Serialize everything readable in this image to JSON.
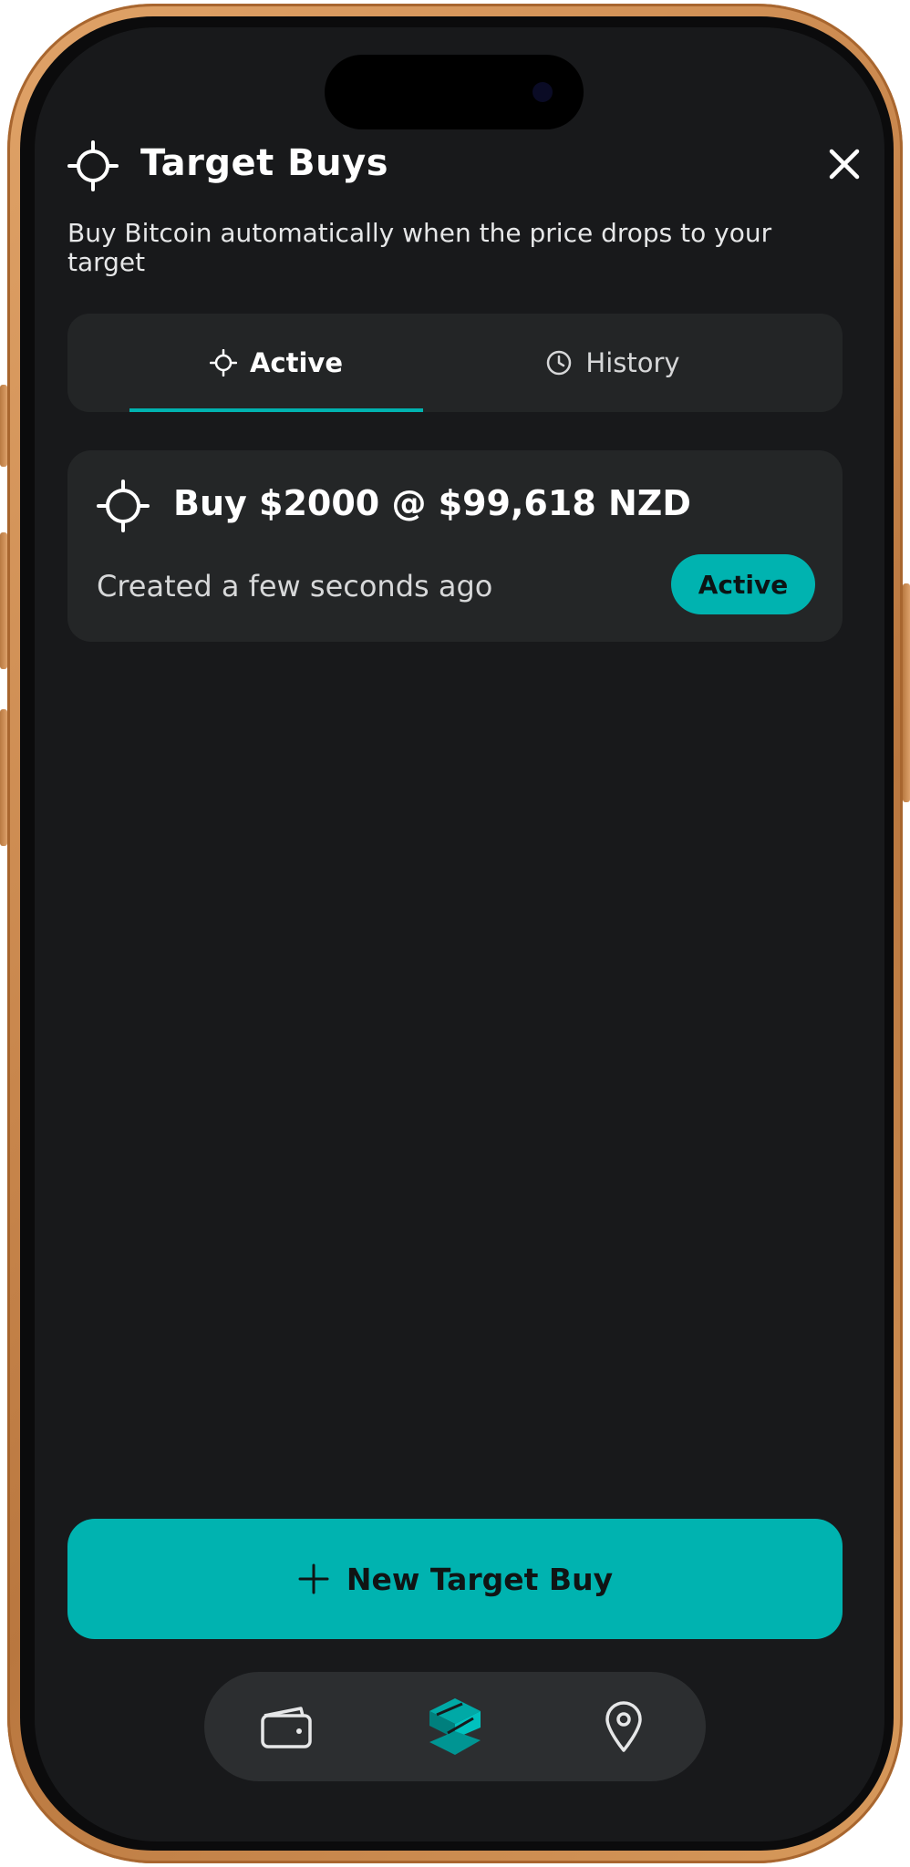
{
  "screen": {
    "title": "Target Buys",
    "subtitle": "Buy Bitcoin automatically when the price drops to your target"
  },
  "tabs": [
    {
      "label": "Active",
      "icon": "crosshair-icon",
      "selected": true
    },
    {
      "label": "History",
      "icon": "clock-icon",
      "selected": false
    }
  ],
  "orders": [
    {
      "title": "Buy $2000 @ $99,618 NZD",
      "created": "Created a few seconds ago",
      "status": "Active",
      "icon": "crosshair-icon"
    }
  ],
  "new_button": {
    "label": "New Target Buy",
    "icon": "plus-icon"
  },
  "bottom_nav": [
    {
      "name": "wallet",
      "icon": "wallet-icon"
    },
    {
      "name": "home",
      "icon": "app-logo-icon",
      "active": true
    },
    {
      "name": "location",
      "icon": "location-pin-icon"
    }
  ],
  "colors": {
    "accent": "#00b3b0",
    "background": "#18191b",
    "card": "#242627",
    "frame": "#c8864c"
  }
}
